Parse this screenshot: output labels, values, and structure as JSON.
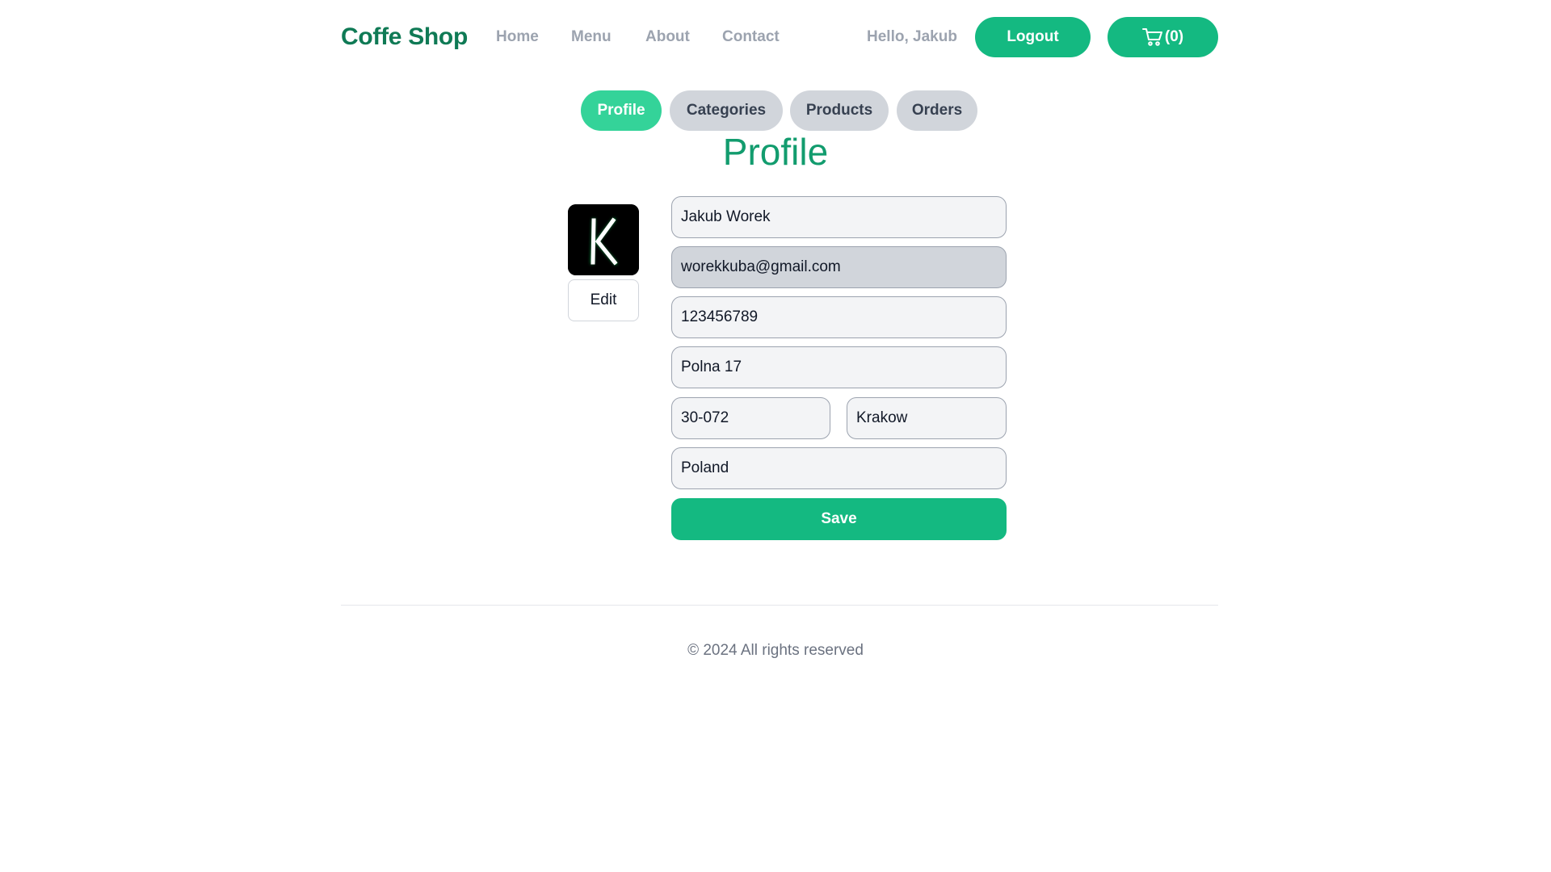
{
  "header": {
    "brand": "Coffe Shop",
    "nav": [
      "Home",
      "Menu",
      "About",
      "Contact"
    ],
    "greeting": "Hello, Jakub",
    "logout_label": "Logout",
    "cart_label": "(0)"
  },
  "tabs": [
    {
      "label": "Profile",
      "active": true
    },
    {
      "label": "Categories",
      "active": false
    },
    {
      "label": "Products",
      "active": false
    },
    {
      "label": "Orders",
      "active": false
    }
  ],
  "profile": {
    "title": "Profile",
    "avatar_letter": "K",
    "edit_label": "Edit",
    "fields": {
      "name": "Jakub Worek",
      "email": "worekkuba@gmail.com",
      "phone": "123456789",
      "street": "Polna 17",
      "zip": "30-072",
      "city": "Krakow",
      "country": "Poland"
    },
    "save_label": "Save"
  },
  "footer": {
    "text": "© 2024 All rights reserved"
  },
  "colors": {
    "brand": "#0f7a55",
    "accent": "#14b981",
    "tab_active": "#34d399",
    "tab_inactive": "#d1d5db"
  }
}
